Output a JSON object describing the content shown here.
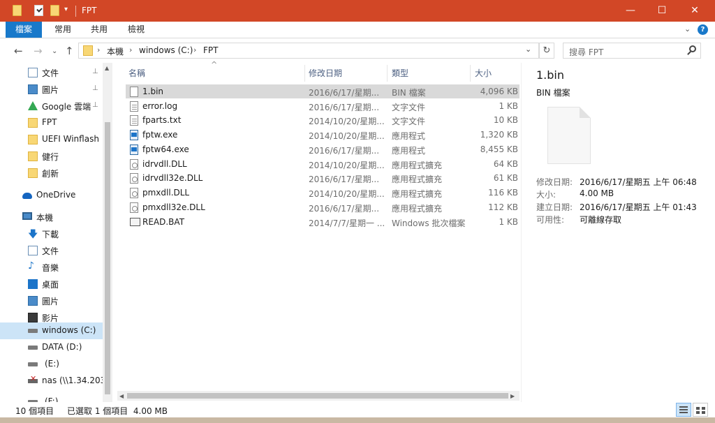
{
  "window": {
    "title": "FPT",
    "minimize_glyph": "—",
    "maximize_glyph": "☐",
    "close_glyph": "✕"
  },
  "colors": {
    "titlebar": "#d24726",
    "file_tab": "#1979ca",
    "selection": "#cce4f7",
    "row_selected": "#d9d9d9"
  },
  "ribbon": {
    "tabs": [
      "檔案",
      "常用",
      "共用",
      "檢視"
    ],
    "collapse_glyph": "⌄",
    "help_glyph": "?"
  },
  "nav": {
    "back_glyph": "←",
    "forward_glyph": "→",
    "recent_glyph": "⌄",
    "up_glyph": "↑"
  },
  "address": {
    "chevron": "›",
    "crumbs": [
      "本機",
      "windows (C:)",
      "FPT"
    ],
    "dropdown_glyph": "⌄",
    "refresh_glyph": "↻"
  },
  "search": {
    "placeholder": "搜尋 FPT"
  },
  "sidebar": {
    "items": [
      {
        "label": "文件",
        "icon": "document-icon",
        "pinned": true
      },
      {
        "label": "圖片",
        "icon": "picture-icon",
        "pinned": true
      },
      {
        "label": "Google 雲端",
        "icon": "google-drive-icon",
        "pinned": true
      },
      {
        "label": "FPT",
        "icon": "folder-icon",
        "pinned": false
      },
      {
        "label": "UEFI Winflash",
        "icon": "folder-icon",
        "pinned": false
      },
      {
        "label": "健行",
        "icon": "folder-icon",
        "pinned": false
      },
      {
        "label": "創新",
        "icon": "folder-icon",
        "pinned": false
      },
      {
        "label": "OneDrive",
        "icon": "onedrive-icon",
        "pinned": false
      },
      {
        "label": "本機",
        "icon": "this-pc-icon",
        "pinned": false
      },
      {
        "label": "下載",
        "icon": "download-icon",
        "pinned": false
      },
      {
        "label": "文件",
        "icon": "document-icon",
        "pinned": false
      },
      {
        "label": "音樂",
        "icon": "music-icon",
        "pinned": false
      },
      {
        "label": "桌面",
        "icon": "desktop-icon",
        "pinned": false
      },
      {
        "label": "圖片",
        "icon": "picture-icon",
        "pinned": false
      },
      {
        "label": "影片",
        "icon": "video-icon",
        "pinned": false
      },
      {
        "label": "windows (C:)",
        "icon": "drive-icon",
        "pinned": false,
        "selected": true
      },
      {
        "label": "DATA (D:)",
        "icon": "drive-icon",
        "pinned": false
      },
      {
        "label": "(E:)",
        "icon": "drive-icon",
        "pinned": false
      },
      {
        "label": "nas (\\\\1.34.203.",
        "icon": "network-drive-icon",
        "pinned": false
      },
      {
        "label": "(F:)",
        "icon": "drive-icon",
        "pinned": false
      }
    ],
    "pin_glyph": "📌"
  },
  "columns": {
    "name": "名稱",
    "date": "修改日期",
    "type": "類型",
    "size": "大小",
    "sort_glyph": "^"
  },
  "files": [
    {
      "name": "1.bin",
      "date": "2016/6/17/星期...",
      "type": "BIN 檔案",
      "size": "4,096 KB",
      "kind": "bin",
      "selected": true
    },
    {
      "name": "error.log",
      "date": "2016/6/17/星期...",
      "type": "文字文件",
      "size": "1 KB",
      "kind": "txt"
    },
    {
      "name": "fparts.txt",
      "date": "2014/10/20/星期...",
      "type": "文字文件",
      "size": "10 KB",
      "kind": "txt"
    },
    {
      "name": "fptw.exe",
      "date": "2014/10/20/星期...",
      "type": "應用程式",
      "size": "1,320 KB",
      "kind": "exe"
    },
    {
      "name": "fptw64.exe",
      "date": "2016/6/17/星期...",
      "type": "應用程式",
      "size": "8,455 KB",
      "kind": "exe"
    },
    {
      "name": "idrvdll.DLL",
      "date": "2014/10/20/星期...",
      "type": "應用程式擴充",
      "size": "64 KB",
      "kind": "dll"
    },
    {
      "name": "idrvdll32e.DLL",
      "date": "2016/6/17/星期...",
      "type": "應用程式擴充",
      "size": "61 KB",
      "kind": "dll"
    },
    {
      "name": "pmxdll.DLL",
      "date": "2014/10/20/星期...",
      "type": "應用程式擴充",
      "size": "116 KB",
      "kind": "dll"
    },
    {
      "name": "pmxdll32e.DLL",
      "date": "2016/6/17/星期...",
      "type": "應用程式擴充",
      "size": "112 KB",
      "kind": "dll"
    },
    {
      "name": "READ.BAT",
      "date": "2014/7/7/星期一 ...",
      "type": "Windows 批次檔案",
      "size": "1 KB",
      "kind": "bat"
    }
  ],
  "details": {
    "name": "1.bin",
    "type": "BIN 檔案",
    "props": [
      {
        "key": "修改日期:",
        "value": "2016/6/17/星期五 上午 06:48"
      },
      {
        "key": "大小:",
        "value": "4.00 MB"
      },
      {
        "key": "建立日期:",
        "value": "2016/6/17/星期五 上午 01:43"
      },
      {
        "key": "可用性:",
        "value": "可離線存取"
      }
    ]
  },
  "status": {
    "count": "10 個項目",
    "selection": "已選取 1 個項目  4.00 MB"
  },
  "scroll": {
    "left_glyph": "◀",
    "right_glyph": "▶"
  }
}
